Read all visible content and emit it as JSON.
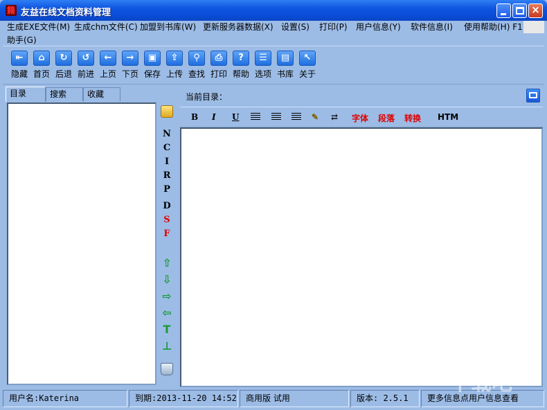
{
  "window": {
    "title": "友益在线文档资料管理",
    "app_icon": "book-stack-icon"
  },
  "menu": [
    {
      "label": "生成EXE文件(M)"
    },
    {
      "label": "生成chm文件(C)"
    },
    {
      "label": "加盟到书库(W)"
    },
    {
      "label": "更新服务器数据(X)"
    },
    {
      "label": "设置(S)"
    },
    {
      "label": "打印(P)"
    },
    {
      "label": "用户信息(Y)"
    },
    {
      "label": "软件信息(I)"
    },
    {
      "label": "使用帮助(H) F1"
    },
    {
      "label": "助手(G)"
    }
  ],
  "toolbar": [
    {
      "label": "隐藏",
      "icon": "hide-panel-icon"
    },
    {
      "label": "首页",
      "icon": "home-icon"
    },
    {
      "label": "后退",
      "icon": "back-refresh-icon"
    },
    {
      "label": "前进",
      "icon": "forward-refresh-icon"
    },
    {
      "label": "上页",
      "icon": "arrow-left-icon"
    },
    {
      "label": "下页",
      "icon": "arrow-right-icon"
    },
    {
      "label": "保存",
      "icon": "save-icon"
    },
    {
      "label": "上传",
      "icon": "upload-icon"
    },
    {
      "label": "查找",
      "icon": "search-icon"
    },
    {
      "label": "打印",
      "icon": "print-icon"
    },
    {
      "label": "帮助",
      "icon": "help-icon"
    },
    {
      "label": "选项",
      "icon": "options-icon"
    },
    {
      "label": "书库",
      "icon": "library-icon"
    },
    {
      "label": "关于",
      "icon": "about-cursor-icon"
    }
  ],
  "left_panel": {
    "tabs": [
      "目录",
      "搜索",
      "收藏"
    ],
    "active_tab": "目录",
    "side_letters": [
      {
        "text": "N",
        "color": "#000000"
      },
      {
        "text": "C",
        "color": "#000000"
      },
      {
        "text": "I",
        "color": "#000000"
      },
      {
        "text": "R",
        "color": "#000000"
      },
      {
        "text": "P",
        "color": "#000000"
      },
      {
        "text": "D",
        "color": "#000000"
      },
      {
        "text": "S",
        "color": "#e00000"
      },
      {
        "text": "F",
        "color": "#e00000"
      }
    ],
    "side_arrows": [
      "⇧",
      "⇩",
      "⇨",
      "⇦",
      "T",
      "⊥"
    ]
  },
  "right_panel": {
    "current_dir_label": "当前目录："
  },
  "format_bar": {
    "bold": "B",
    "italic": "I",
    "underline": "U",
    "font": "字体",
    "paragraph": "段落",
    "convert": "转换",
    "html": "HTM"
  },
  "status": {
    "user": "用户名:Katerina",
    "expiry": "到期:2013-11-20 14:52",
    "edition": "商用版 试用",
    "version": "版本: 2.5.1",
    "more_info": "更多信息点用户信息查看"
  },
  "watermark": "下载吧",
  "colors": {
    "window_bg": "#9cbce6",
    "title_blue": "#0a4bd4",
    "accent_red": "#e00000"
  }
}
